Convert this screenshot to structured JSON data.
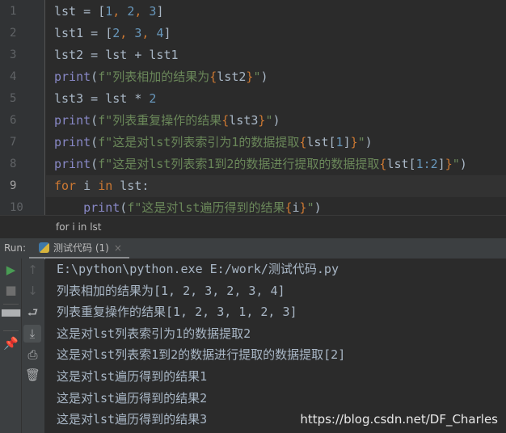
{
  "editor": {
    "current_line": 9,
    "lines": [
      {
        "n": "1",
        "tokens": [
          [
            "pl",
            "lst = "
          ],
          [
            "pl",
            "["
          ],
          [
            "num",
            "1"
          ],
          [
            "kw",
            ", "
          ],
          [
            "num",
            "2"
          ],
          [
            "kw",
            ", "
          ],
          [
            "num",
            "3"
          ],
          [
            "pl",
            "]"
          ]
        ]
      },
      {
        "n": "2",
        "tokens": [
          [
            "pl",
            "lst1 = "
          ],
          [
            "pl",
            "["
          ],
          [
            "num",
            "2"
          ],
          [
            "kw",
            ", "
          ],
          [
            "num",
            "3"
          ],
          [
            "kw",
            ", "
          ],
          [
            "num",
            "4"
          ],
          [
            "pl",
            "]"
          ]
        ]
      },
      {
        "n": "3",
        "tokens": [
          [
            "pl",
            "lst2 = lst + lst1"
          ]
        ]
      },
      {
        "n": "4",
        "tokens": [
          [
            "fn",
            "print"
          ],
          [
            "pl",
            "("
          ],
          [
            "str",
            "f\"列表相加的结果为"
          ],
          [
            "br",
            "{"
          ],
          [
            "pl",
            "lst2"
          ],
          [
            "br",
            "}"
          ],
          [
            "str",
            "\""
          ],
          [
            "pl",
            ")"
          ]
        ]
      },
      {
        "n": "5",
        "tokens": [
          [
            "pl",
            "lst3 = lst * "
          ],
          [
            "num",
            "2"
          ]
        ]
      },
      {
        "n": "6",
        "tokens": [
          [
            "fn",
            "print"
          ],
          [
            "pl",
            "("
          ],
          [
            "str",
            "f\"列表重复操作的结果"
          ],
          [
            "br",
            "{"
          ],
          [
            "pl",
            "lst3"
          ],
          [
            "br",
            "}"
          ],
          [
            "str",
            "\""
          ],
          [
            "pl",
            ")"
          ]
        ]
      },
      {
        "n": "7",
        "tokens": [
          [
            "fn",
            "print"
          ],
          [
            "pl",
            "("
          ],
          [
            "str",
            "f\"这是对lst列表索引为1的数据提取"
          ],
          [
            "br",
            "{"
          ],
          [
            "pl",
            "lst["
          ],
          [
            "num",
            "1"
          ],
          [
            "pl",
            "]"
          ],
          [
            "br",
            "}"
          ],
          [
            "str",
            "\""
          ],
          [
            "pl",
            ")"
          ]
        ]
      },
      {
        "n": "8",
        "tokens": [
          [
            "fn",
            "print"
          ],
          [
            "pl",
            "("
          ],
          [
            "str",
            "f\"这是对lst列表索1到2的数据进行提取的数据提取"
          ],
          [
            "br",
            "{"
          ],
          [
            "pl",
            "lst["
          ],
          [
            "num",
            "1:2"
          ],
          [
            "pl",
            "]"
          ],
          [
            "br",
            "}"
          ],
          [
            "str",
            "\""
          ],
          [
            "pl",
            ")"
          ]
        ]
      },
      {
        "n": "9",
        "tokens": [
          [
            "kw",
            "for"
          ],
          [
            "pl",
            " i "
          ],
          [
            "kw",
            "in"
          ],
          [
            "pl",
            " lst:"
          ]
        ]
      },
      {
        "n": "10",
        "tokens": [
          [
            "pl",
            "    "
          ],
          [
            "fn",
            "print"
          ],
          [
            "pl",
            "("
          ],
          [
            "str",
            "f\"这是对lst遍历得到的结果"
          ],
          [
            "br",
            "{"
          ],
          [
            "pl",
            "i"
          ],
          [
            "br",
            "}"
          ],
          [
            "str",
            "\""
          ],
          [
            "pl",
            ")"
          ]
        ]
      }
    ]
  },
  "breadcrumb": "for i in lst",
  "run": {
    "label": "Run:",
    "tab": "测试代码 (1)",
    "close": "×"
  },
  "console": {
    "lines": [
      "E:\\python\\python.exe E:/work/测试代码.py",
      "列表相加的结果为[1, 2, 3, 2, 3, 4]",
      "列表重复操作的结果[1, 2, 3, 1, 2, 3]",
      "这是对lst列表索引为1的数据提取2",
      "这是对lst列表索1到2的数据进行提取的数据提取[2]",
      "这是对lst遍历得到的结果1",
      "这是对lst遍历得到的结果2",
      "这是对lst遍历得到的结果3"
    ]
  },
  "toolbar": {
    "left": [
      "run-icon",
      "stop-icon",
      "layout-icon",
      "pin-icon"
    ],
    "right": [
      "up-arrow-icon",
      "down-arrow-icon",
      "soft-wrap-icon",
      "scroll-to-end-icon",
      "print-icon",
      "trash-icon"
    ]
  },
  "watermark": "https://blog.csdn.net/DF_Charles"
}
